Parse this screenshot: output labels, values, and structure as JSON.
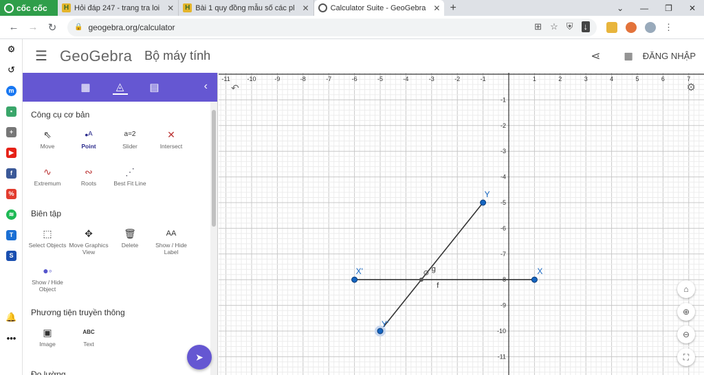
{
  "browser": {
    "brand": "cốc cốc",
    "tabs": [
      {
        "title": "Hỏi đáp 247 - trang tra loi",
        "active": false
      },
      {
        "title": "Bài 1 quy đồng mẫu số các pl",
        "active": false
      },
      {
        "title": "Calculator Suite - GeoGebra",
        "active": true
      }
    ],
    "url": "geogebra.org/calculator"
  },
  "header": {
    "logo": "GeoGebra",
    "title": "Bộ máy tính",
    "login": "ĐĂNG NHẬP"
  },
  "panel": {
    "sections": [
      {
        "title": "Công cụ cơ bản",
        "tools": [
          {
            "label": "Move",
            "icon": "cursor-icon"
          },
          {
            "label": "Point",
            "icon": "point-icon",
            "selected": true
          },
          {
            "label": "Slider",
            "icon": "slider-icon"
          },
          {
            "label": "Intersect",
            "icon": "intersect-icon"
          },
          {
            "label": "Extremum",
            "icon": "extremum-icon"
          },
          {
            "label": "Roots",
            "icon": "roots-icon"
          },
          {
            "label": "Best Fit Line",
            "icon": "best-fit-icon"
          }
        ]
      },
      {
        "title": "Biên tập",
        "tools": [
          {
            "label": "Select Objects",
            "icon": "select-icon"
          },
          {
            "label": "Move Graphics View",
            "icon": "move-view-icon"
          },
          {
            "label": "Delete",
            "icon": "trash-icon"
          },
          {
            "label": "Show / Hide Label",
            "icon": "label-icon"
          },
          {
            "label": "Show / Hide Object",
            "icon": "show-hide-icon"
          }
        ]
      },
      {
        "title": "Phương tiện truyền thông",
        "tools": [
          {
            "label": "Image",
            "icon": "image-icon"
          },
          {
            "label": "Text",
            "icon": "text-icon"
          }
        ]
      },
      {
        "title": "Đo lường",
        "tools": []
      }
    ]
  },
  "graph": {
    "x_ticks": [
      "-11",
      "-10",
      "-9",
      "-8",
      "-7",
      "-6",
      "-5",
      "-4",
      "-3",
      "-2",
      "-1",
      "1",
      "2",
      "3",
      "4",
      "5",
      "6",
      "7"
    ],
    "y_ticks": [
      "-1",
      "-2",
      "-3",
      "-4",
      "-5",
      "-6",
      "-7",
      "-8",
      "-9",
      "-10",
      "-11"
    ],
    "points": [
      {
        "label": "X'",
        "x": -6,
        "y": -8
      },
      {
        "label": "X",
        "x": 1,
        "y": -8
      },
      {
        "label": "Y",
        "x": -1,
        "y": -5
      },
      {
        "label": "Y'",
        "x": -5,
        "y": -10
      }
    ],
    "line_labels": [
      "f",
      "g"
    ],
    "intersection": {
      "x": -3.4,
      "y": -8
    }
  }
}
